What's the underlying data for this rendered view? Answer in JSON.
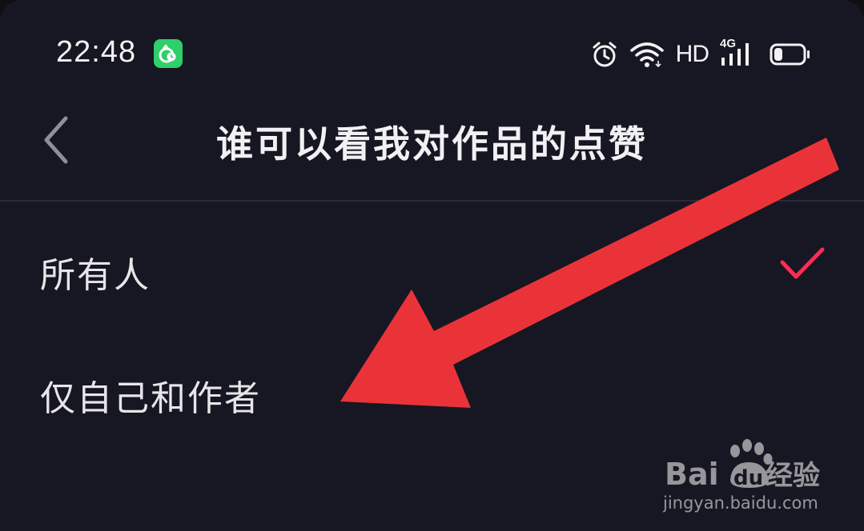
{
  "status_bar": {
    "time": "22:48",
    "app_badge_icon": "app-notification-icon",
    "icons": [
      "alarm-icon",
      "wifi-icon",
      "hd-icon",
      "signal-4g-icon",
      "battery-icon"
    ],
    "hd_label": "HD",
    "network_label": "4G",
    "battery_level": 0.3
  },
  "header": {
    "back_icon": "chevron-left-icon",
    "title": "谁可以看我对作品的点赞"
  },
  "options": [
    {
      "label": "所有人",
      "selected": true
    },
    {
      "label": "仅自己和作者",
      "selected": false
    }
  ],
  "colors": {
    "background": "#161722",
    "check_accent": "#fe2c55",
    "arrow": "#ea3339",
    "app_badge": "#2fcf6a"
  },
  "watermark": {
    "brand": "Bai",
    "brand2": "du",
    "suffix": "经验",
    "url": "jingyan.baidu.com"
  }
}
